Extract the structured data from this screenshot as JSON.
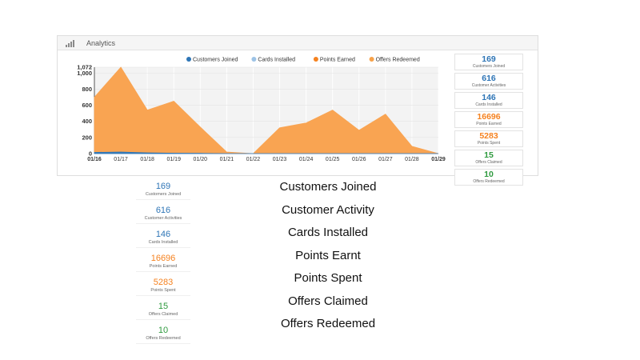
{
  "panel": {
    "title": "Analytics",
    "icon": "bar-signal-icon"
  },
  "colors": {
    "blue": "#2e75b6",
    "light_blue": "#9dc3e6",
    "orange": "#f58220",
    "light_orange": "#f7a24a",
    "green": "#2e9a3e",
    "area_fill": "#f9a452",
    "text_gray": "#555555"
  },
  "chart_data": {
    "type": "area",
    "legend_position": "top",
    "x": [
      "01/16",
      "01/17",
      "01/18",
      "01/19",
      "01/20",
      "01/21",
      "01/22",
      "01/23",
      "01/24",
      "01/25",
      "01/26",
      "01/27",
      "01/28",
      "01/29"
    ],
    "ylim": [
      0,
      1072
    ],
    "yticks": [
      0,
      200,
      400,
      600,
      800,
      1000,
      1072
    ],
    "grid": true,
    "series": [
      {
        "name": "Customers Joined",
        "color": "#2e75b6",
        "values": [
          15,
          20,
          10,
          5,
          3,
          0,
          0,
          0,
          0,
          0,
          0,
          0,
          0,
          0
        ]
      },
      {
        "name": "Cards Installed",
        "color": "#9dc3e6",
        "values": [
          8,
          12,
          6,
          4,
          2,
          0,
          0,
          0,
          0,
          0,
          0,
          0,
          0,
          0
        ]
      },
      {
        "name": "Points Earned",
        "color": "#f58220",
        "values": [
          700,
          1072,
          540,
          650,
          330,
          20,
          0,
          320,
          380,
          540,
          290,
          490,
          90,
          0
        ]
      },
      {
        "name": "Offers Redeemed",
        "color": "#f7a24a",
        "values": [
          0,
          0,
          0,
          0,
          0,
          0,
          0,
          0,
          0,
          0,
          0,
          0,
          0,
          0
        ]
      }
    ]
  },
  "stats": [
    {
      "value": "169",
      "label": "Customers Joined",
      "color": "#2e75b6"
    },
    {
      "value": "616",
      "label": "Customer Activities",
      "color": "#2e75b6"
    },
    {
      "value": "146",
      "label": "Cards Installed",
      "color": "#2e75b6"
    },
    {
      "value": "16696",
      "label": "Points Earned",
      "color": "#f58220"
    },
    {
      "value": "5283",
      "label": "Points Spent",
      "color": "#f58220"
    },
    {
      "value": "15",
      "label": "Offers Claimed",
      "color": "#2e9a3e"
    },
    {
      "value": "10",
      "label": "Offers Redeemed",
      "color": "#2e9a3e"
    }
  ],
  "descriptions": [
    "Customers Joined",
    "Customer Activity",
    "Cards Installed",
    "Points Earnt",
    "Points Spent",
    "Offers Claimed",
    "Offers Redeemed"
  ]
}
